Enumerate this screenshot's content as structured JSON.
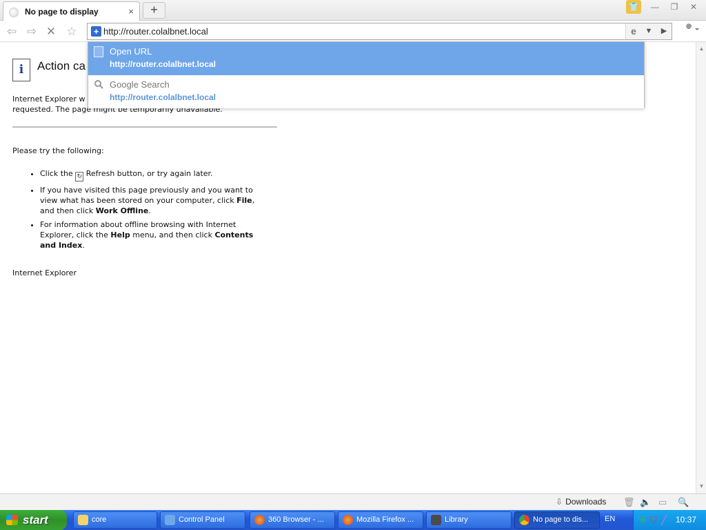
{
  "browser": {
    "tab": {
      "title": "No page to display",
      "close": "×"
    },
    "new_tab": "+",
    "window_controls": {
      "skin": "👕",
      "minimize": "—",
      "restore": "❐",
      "close": "✕"
    },
    "toolbar": {
      "back": "⇦",
      "forward": "⇨",
      "stop": "✕",
      "favorite": "☆"
    },
    "address": {
      "value": "http://router.colalbnet.local",
      "site_icon": "+"
    },
    "address_side": {
      "engine": "e",
      "dropdown": "▼",
      "go": "▶"
    },
    "tools_icon": "wrench-icon"
  },
  "dropdown": {
    "items": [
      {
        "label": "Open URL",
        "url": "http://router.colalbnet.local",
        "icon": "page-icon",
        "selected": true
      },
      {
        "label": "Google Search",
        "url": "http://router.colalbnet.local",
        "icon": "search-icon",
        "selected": false
      }
    ],
    "highlight_color": "#6ea6e9"
  },
  "page": {
    "heading": "Action ca",
    "description_line1": "Internet Explorer w",
    "description_line2": "requested. The page might be temporarily unavailable.",
    "try_heading": "Please try the following:",
    "tips": [
      {
        "before": "Click the ",
        "after": " Refresh button, or try again later."
      },
      {
        "text": "If you have visited this page previously and you want to view what has been stored on your computer, click ",
        "bold1": "File",
        "mid": ", and then click ",
        "bold2": "Work Offline",
        "end": "."
      },
      {
        "text": "For information about offline browsing with Internet Explorer, click the ",
        "bold1": "Help",
        "mid": " menu, and then click ",
        "bold2": "Contents and Index",
        "end": "."
      }
    ],
    "footer": "Internet Explorer"
  },
  "statusbar": {
    "downloads": "Downloads"
  },
  "taskbar": {
    "start": "start",
    "tasks": [
      {
        "label": "core",
        "icon": "folder-icon"
      },
      {
        "label": "Control Panel",
        "icon": "control-panel-icon"
      },
      {
        "label": "360 Browser - ...",
        "icon": "firefox-icon"
      },
      {
        "label": "Mozilla Firefox ...",
        "icon": "firefox-icon"
      },
      {
        "label": "Library",
        "icon": "library-icon"
      },
      {
        "label": "No page to dis...",
        "icon": "browser-icon",
        "active": true
      }
    ],
    "language": "EN",
    "clock": "10:37"
  }
}
